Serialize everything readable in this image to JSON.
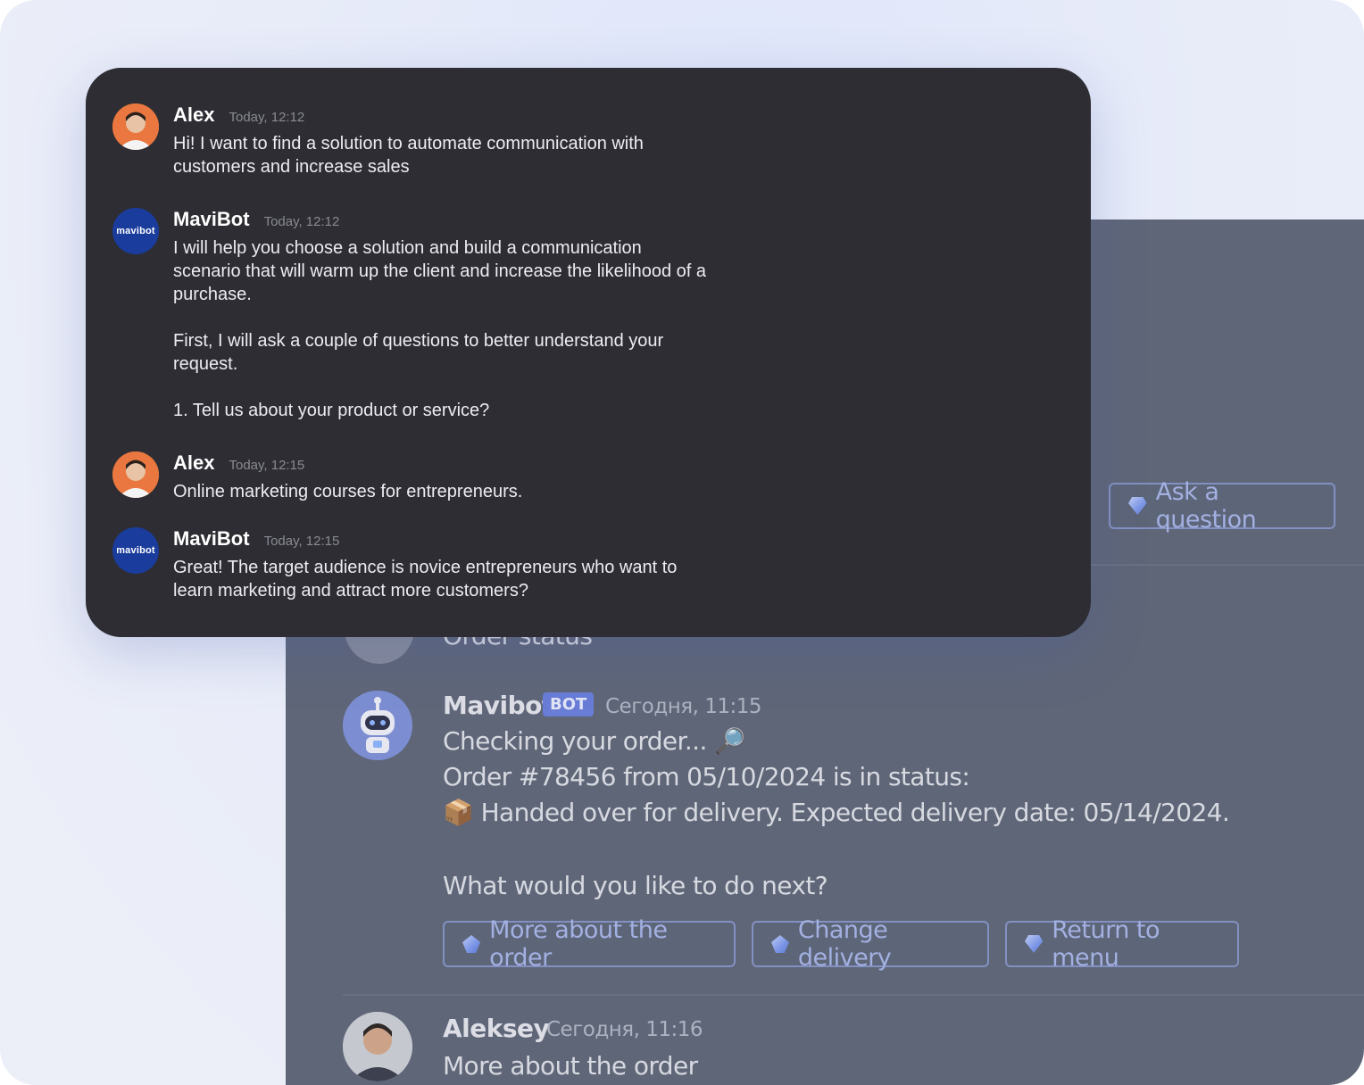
{
  "chat": {
    "messages": [
      {
        "author": "Alex",
        "time": "Today, 12:12",
        "text": "Hi! I want to find a solution to automate communication with customers and increase sales"
      },
      {
        "author": "MaviBot",
        "time": "Today, 12:12",
        "text": "I will help you choose a solution and build a communication scenario that will warm up the client and increase the likelihood of a purchase.\n\nFirst, I will ask a couple of questions to better understand your request.\n\n1. Tell us about your product or service?"
      },
      {
        "author": "Alex",
        "time": "Today, 12:15",
        "text": "Online marketing courses for entrepreneurs."
      },
      {
        "author": "MaviBot",
        "time": "Today, 12:15",
        "text": "Great! The target audience is novice entrepreneurs who want to learn marketing and attract more customers?"
      }
    ],
    "bot_logo_text": "mavibot"
  },
  "background_chat": {
    "top_button": "Ask a question",
    "partial_text": "Order status",
    "bot_message": {
      "author": "Mavibot",
      "badge": "BOT",
      "time": "Сегодня, 11:15",
      "line1": "Checking your order... 🔎",
      "line2": "Order #78456 from 05/10/2024 is in status:",
      "line3": "📦 Handed over for delivery. Expected delivery date: 05/14/2024.",
      "line4": "What would you like to do next?"
    },
    "buttons": [
      "More about the order",
      "Change delivery",
      "Return to menu"
    ],
    "user_message": {
      "author": "Aleksey",
      "time": "Сегодня, 11:16",
      "text": "More about the order"
    }
  },
  "colors": {
    "card_bg": "#2d2d33",
    "bot_avatar": "#1a3c9c",
    "user_avatar": "#e9773f",
    "button_border": "#8796c9"
  }
}
